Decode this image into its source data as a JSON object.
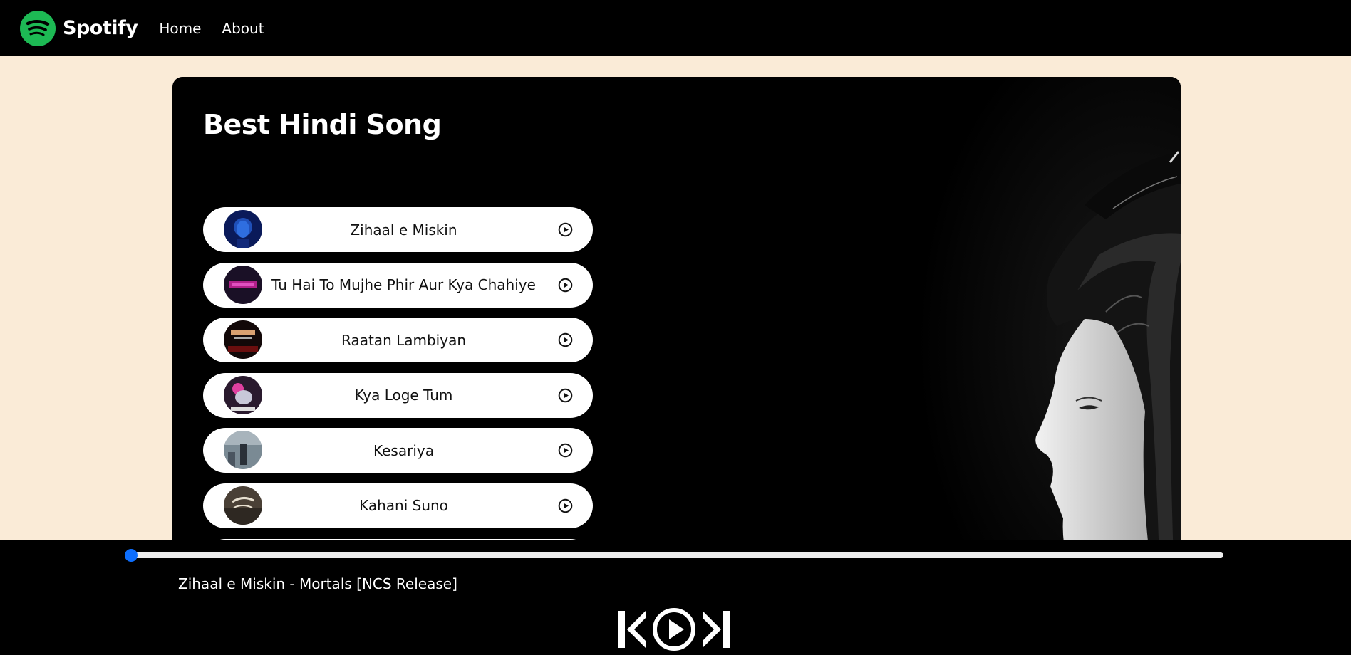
{
  "nav": {
    "brand": "Spotify",
    "links": [
      "Home",
      "About"
    ]
  },
  "playlist": {
    "title": "Best Hindi Song",
    "songs": [
      {
        "name": "Zihaal e Miskin",
        "cover": "cover-1"
      },
      {
        "name": "Tu Hai To Mujhe Phir Aur Kya Chahiye",
        "cover": "cover-2"
      },
      {
        "name": "Raatan Lambiyan",
        "cover": "cover-3"
      },
      {
        "name": "Kya Loge Tum",
        "cover": "cover-4"
      },
      {
        "name": "Kesariya",
        "cover": "cover-5"
      },
      {
        "name": "Kahani Suno",
        "cover": "cover-6"
      }
    ]
  },
  "player": {
    "now_playing": "Zihaal e Miskin - Mortals [NCS Release]",
    "progress": 0.0,
    "controls": [
      "previous-icon",
      "play-circle-icon",
      "next-icon"
    ]
  },
  "colors": {
    "brand_green": "#1DB954",
    "page_bg": "#FAEBD7",
    "accent_blue": "#0d6efd"
  }
}
